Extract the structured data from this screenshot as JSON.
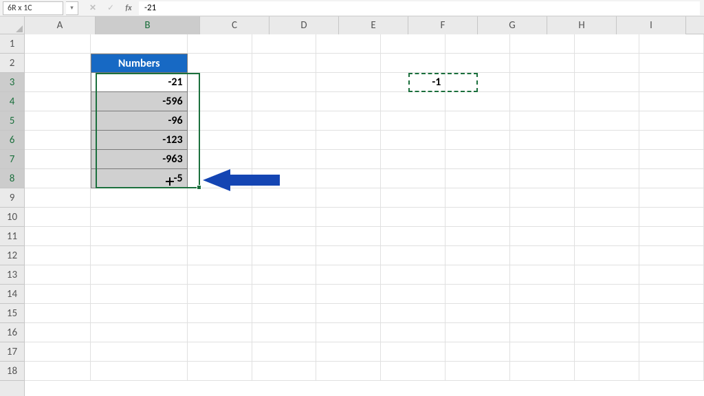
{
  "name_box": "6R x 1C",
  "formula_bar_value": "-21",
  "columns": [
    "A",
    "B",
    "C",
    "D",
    "E",
    "F",
    "G",
    "H",
    "I"
  ],
  "column_widths": {
    "A": 103,
    "B": 152,
    "other": 101
  },
  "selected_column": "B",
  "rows_visible": 18,
  "selected_rows": [
    3,
    4,
    5,
    6,
    7,
    8
  ],
  "selection_range": "B3:B8",
  "active_cell": "B3",
  "copy_cell": "F3",
  "numbers_header": "Numbers",
  "numbers_values": [
    "-21",
    "-596",
    "-96",
    "-123",
    "-963",
    "-5"
  ],
  "f3_value": "-1",
  "icons": {
    "fx": "fx",
    "ok": "✓",
    "cancel": "✕",
    "caret": "▾"
  }
}
